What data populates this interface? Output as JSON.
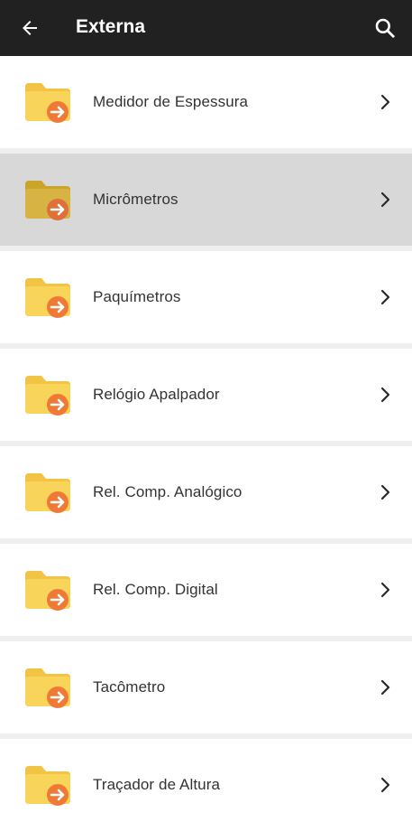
{
  "header": {
    "title": "Externa",
    "back_icon": "arrow-back-icon",
    "search_icon": "search-icon",
    "background": "#212121"
  },
  "list": {
    "selected_index": 1,
    "items": [
      {
        "label": "Medidor de Espessura"
      },
      {
        "label": "Micrômetros"
      },
      {
        "label": "Paquímetros"
      },
      {
        "label": "Relógio Apalpador"
      },
      {
        "label": "Rel. Comp. Analógico"
      },
      {
        "label": "Rel. Comp. Digital"
      },
      {
        "label": "Tacômetro"
      },
      {
        "label": "Traçador de Altura"
      }
    ],
    "item_icon": "folder-arrow-icon",
    "chevron_icon": "chevron-right-icon",
    "colors": {
      "folder": "#f9d45a",
      "folder_back": "#f2c443",
      "badge": "#ef7a36",
      "selected_row": "#d8d8d8"
    }
  }
}
